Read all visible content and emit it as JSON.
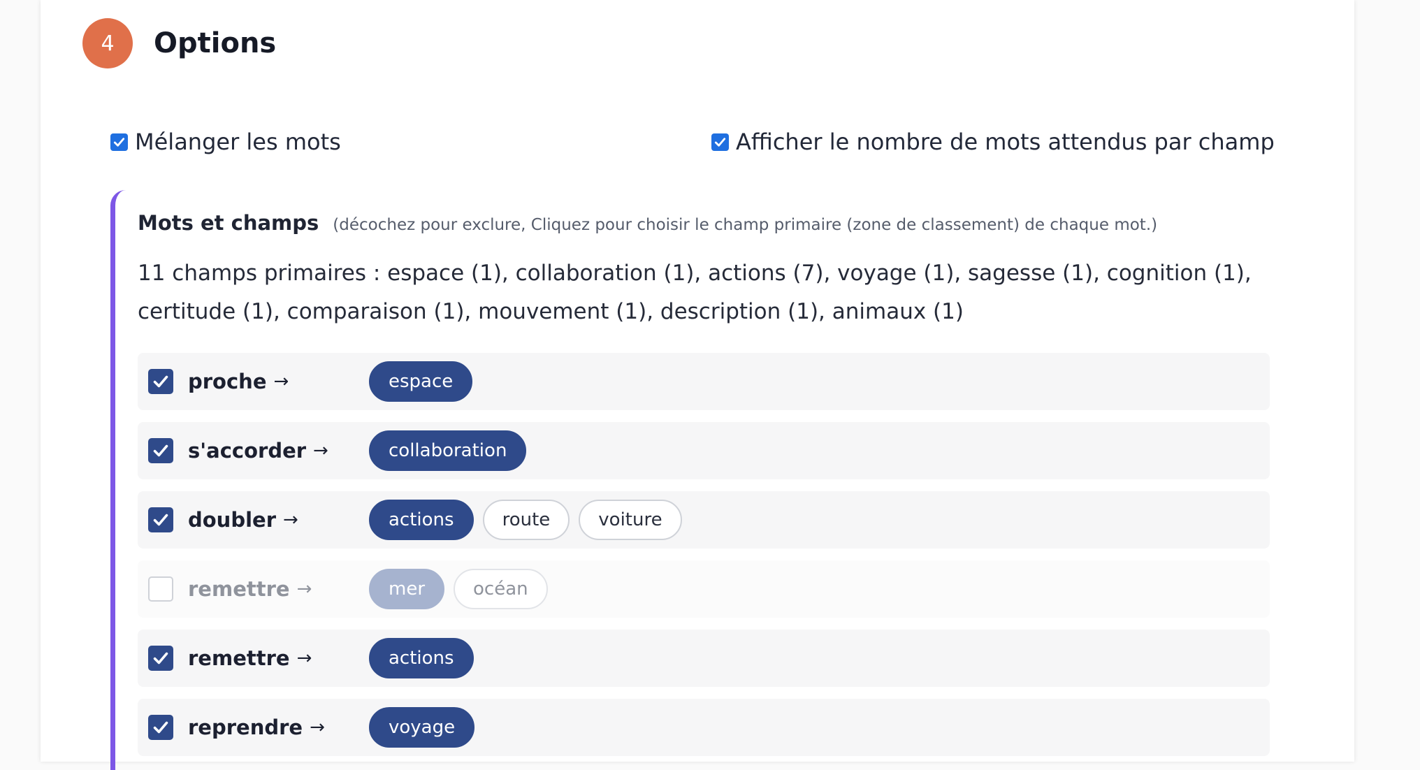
{
  "step": {
    "number": "4",
    "title": "Options"
  },
  "options": {
    "shuffle_label": "Mélanger les mots",
    "shuffle_checked": true,
    "show_count_label": "Afficher le nombre de mots attendus par champ",
    "show_count_checked": true
  },
  "section": {
    "title": "Mots et champs",
    "hint": "(décochez pour exclure, Cliquez pour choisir le champ primaire (zone de classement) de chaque mot.)",
    "summary": "11 champs primaires : espace (1), collaboration (1), actions (7), voyage (1), sagesse (1), cognition (1), certitude (1), comparaison (1), mouvement (1), description (1), animaux (1)"
  },
  "rows": [
    {
      "word": "proche",
      "checked": true,
      "fields": [
        {
          "label": "espace",
          "primary": true
        }
      ]
    },
    {
      "word": "s'accorder",
      "checked": true,
      "fields": [
        {
          "label": "collaboration",
          "primary": true
        }
      ]
    },
    {
      "word": "doubler",
      "checked": true,
      "fields": [
        {
          "label": "actions",
          "primary": true
        },
        {
          "label": "route",
          "primary": false
        },
        {
          "label": "voiture",
          "primary": false
        }
      ]
    },
    {
      "word": "remettre",
      "checked": false,
      "fields": [
        {
          "label": "mer",
          "primary": true
        },
        {
          "label": "océan",
          "primary": false
        }
      ]
    },
    {
      "word": "remettre",
      "checked": true,
      "fields": [
        {
          "label": "actions",
          "primary": true
        }
      ]
    },
    {
      "word": "reprendre",
      "checked": true,
      "fields": [
        {
          "label": "voyage",
          "primary": true
        }
      ]
    }
  ],
  "icons": {
    "arrow": "→"
  },
  "colors": {
    "step_badge": "#e0704a",
    "section_accent": "#7d57e6",
    "primary_chip": "#2f4a8a",
    "checkbox_blue": "#1f6fe0"
  }
}
